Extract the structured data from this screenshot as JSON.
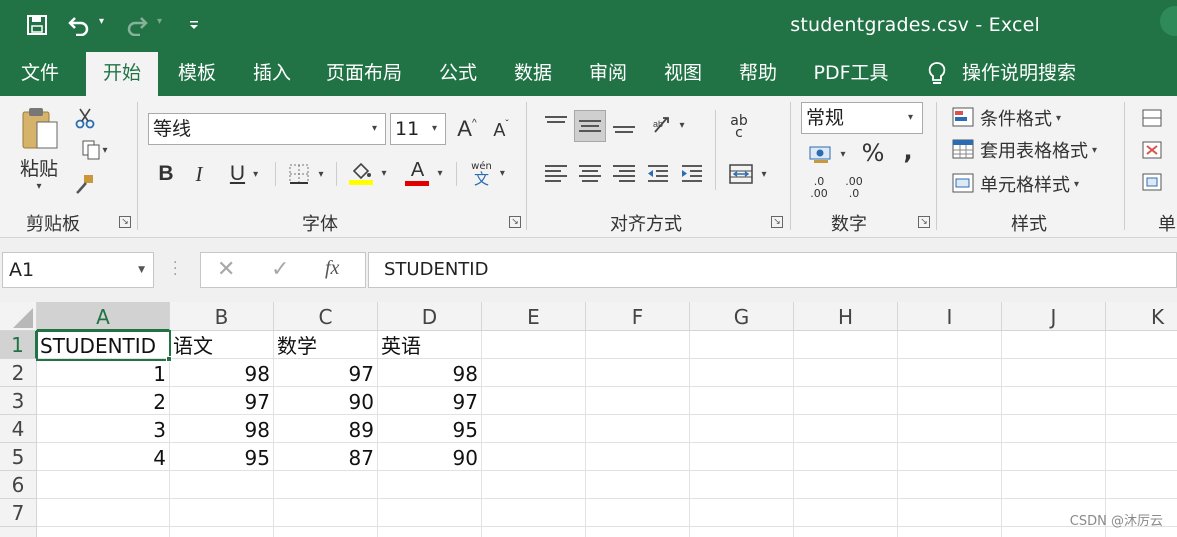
{
  "window": {
    "title": "studentgrades.csv  -  Excel",
    "quick_access": [
      "save-icon",
      "undo-icon",
      "redo-icon",
      "customize-icon"
    ]
  },
  "menu": {
    "tabs": [
      "文件",
      "开始",
      "模板",
      "插入",
      "页面布局",
      "公式",
      "数据",
      "审阅",
      "视图",
      "帮助",
      "PDF工具"
    ],
    "active": "开始",
    "tell_me": "操作说明搜索"
  },
  "ribbon": {
    "clipboard": {
      "label": "剪贴板",
      "paste": "粘贴"
    },
    "font": {
      "label": "字体",
      "name": "等线",
      "size": "11",
      "grow": "A",
      "shrink": "A",
      "bold": "B",
      "italic": "I",
      "underline": "U",
      "font_color_letter": "A",
      "phonetic_top": "wén",
      "phonetic_bottom": "文",
      "highlight_color": "#ffff00",
      "font_color": "#e00000"
    },
    "alignment": {
      "label": "对齐方式",
      "wrap_top": "ab",
      "wrap_bottom": "c"
    },
    "number": {
      "label": "数字",
      "format": "常规",
      "percent": "%",
      "comma": ",",
      "inc_decimal": [
        ".0",
        ".00"
      ],
      "dec_decimal": [
        ".00",
        ".0"
      ]
    },
    "styles": {
      "label": "样式",
      "conditional": "条件格式",
      "table": "套用表格格式",
      "cell": "单元格样式"
    },
    "cells": {
      "label": "单"
    }
  },
  "formula_bar": {
    "name_box": "A1",
    "fx": "fx",
    "content": "STUDENTID"
  },
  "sheet": {
    "columns": [
      "A",
      "B",
      "C",
      "D",
      "E",
      "F",
      "G",
      "H",
      "I",
      "J",
      "K"
    ],
    "rows": [
      "1",
      "2",
      "3",
      "4",
      "5",
      "6",
      "7"
    ],
    "cells": [
      [
        "STUDENTID",
        "语文",
        "数学",
        "英语"
      ],
      [
        "1",
        "98",
        "97",
        "98"
      ],
      [
        "2",
        "97",
        "90",
        "97"
      ],
      [
        "3",
        "98",
        "89",
        "95"
      ],
      [
        "4",
        "95",
        "87",
        "90"
      ]
    ],
    "selected_cell": "A1"
  },
  "watermark": "CSDN @沐厉云",
  "colors": {
    "accent": "#217346",
    "ribbon_bg": "#f3f3f3"
  }
}
